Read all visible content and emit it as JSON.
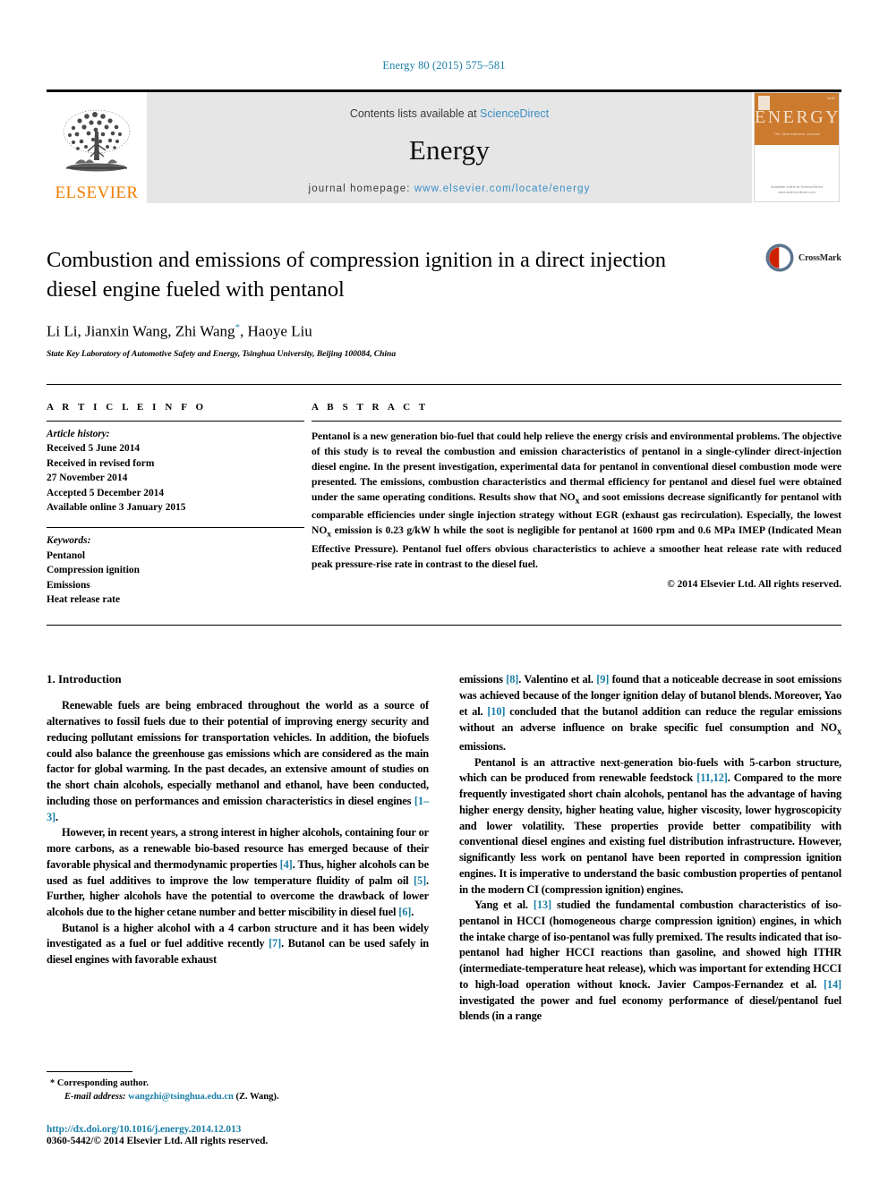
{
  "running_head": "Energy 80 (2015) 575–581",
  "masthead": {
    "publisher_logo_name": "elsevier-tree-logo",
    "publisher_wordmark": "ELSEVIER",
    "contents_prefix": "Contents lists available at ",
    "contents_link": "ScienceDirect",
    "journal_name": "Energy",
    "homepage_label": "journal homepage: ",
    "homepage_url": "www.elsevier.com/locate/energy",
    "cover": {
      "title": "ENERGY",
      "issue_label": "Vol 80",
      "subtitle": "The International Journal",
      "footer": "Available online at\nScienceDirect\nwww.sciencedirect.com"
    }
  },
  "article": {
    "title": "Combustion and emissions of compression ignition in a direct injection diesel engine fueled with pentanol",
    "authors": "Li Li, Jianxin Wang, Zhi Wang",
    "author_star": "*",
    "authors_tail": ", Haoye Liu",
    "affiliation": "State Key Laboratory of Automotive Safety and Energy, Tsinghua University, Beijing 100084, China",
    "crossmark_label": "CrossMark"
  },
  "info": {
    "heading": "A R T I C L E  I N F O",
    "history_label": "Article history:",
    "history": [
      "Received 5 June 2014",
      "Received in revised form",
      "27 November 2014",
      "Accepted 5 December 2014",
      "Available online 3 January 2015"
    ],
    "keywords_label": "Keywords:",
    "keywords": [
      "Pentanol",
      "Compression ignition",
      "Emissions",
      "Heat release rate"
    ]
  },
  "abstract": {
    "heading": "A B S T R A C T",
    "paragraphs": [
      "Pentanol is a new generation bio-fuel that could help relieve the energy crisis and environmental problems. The objective of this study is to reveal the combustion and emission characteristics of pentanol in a single-cylinder direct-injection diesel engine. In the present investigation, experimental data for pentanol in conventional diesel combustion mode were presented. The emissions, combustion characteristics and thermal efficiency for pentanol and diesel fuel were obtained under the same operating conditions. Results show that NOx and soot emissions decrease significantly for pentanol with comparable efficiencies under single injection strategy without EGR (exhaust gas recirculation). Especially, the lowest NOx emission is 0.23 g/kW h while the soot is negligible for pentanol at 1600 rpm and 0.6 MPa IMEP (Indicated Mean Effective Pressure). Pentanol fuel offers obvious characteristics to achieve a smoother heat release rate with reduced peak pressure-rise rate in contrast to the diesel fuel."
    ],
    "copyright": "© 2014 Elsevier Ltd. All rights reserved."
  },
  "body": {
    "section_number_title": "1. Introduction",
    "left_paragraphs": [
      "Renewable fuels are being embraced throughout the world as a source of alternatives to fossil fuels due to their potential of improving energy security and reducing pollutant emissions for transportation vehicles. In addition, the biofuels could also balance the greenhouse gas emissions which are considered as the main factor for global warming. In the past decades, an extensive amount of studies on the short chain alcohols, especially methanol and ethanol, have been conducted, including those on performances and emission characteristics in diesel engines [1–3].",
      "However, in recent years, a strong interest in higher alcohols, containing four or more carbons, as a renewable bio-based resource has emerged because of their favorable physical and thermodynamic properties [4]. Thus, higher alcohols can be used as fuel additives to improve the low temperature fluidity of palm oil [5]. Further, higher alcohols have the potential to overcome the drawback of lower alcohols due to the higher cetane number and better miscibility in diesel fuel [6].",
      "Butanol is a higher alcohol with a 4 carbon structure and it has been widely investigated as a fuel or fuel additive recently [7]. Butanol can be used safely in diesel engines with favorable exhaust"
    ],
    "right_paragraphs": [
      "emissions [8]. Valentino et al. [9] found that a noticeable decrease in soot emissions was achieved because of the longer ignition delay of butanol blends. Moreover, Yao et al. [10] concluded that the butanol addition can reduce the regular emissions without an adverse influence on brake specific fuel consumption and NOx emissions.",
      "Pentanol is an attractive next-generation bio-fuels with 5-carbon structure, which can be produced from renewable feedstock [11,12]. Compared to the more frequently investigated short chain alcohols, pentanol has the advantage of having higher energy density, higher heating value, higher viscosity, lower hygroscopicity and lower volatility. These properties provide better compatibility with conventional diesel engines and existing fuel distribution infrastructure. However, significantly less work on pentanol have been reported in compression ignition engines. It is imperative to understand the basic combustion properties of pentanol in the modern CI (compression ignition) engines.",
      "Yang et al. [13] studied the fundamental combustion characteristics of iso-pentanol in HCCI (homogeneous charge compression ignition) engines, in which the intake charge of iso-pentanol was fully premixed. The results indicated that iso-pentanol had higher HCCI reactions than gasoline, and showed high ITHR (intermediate-temperature heat release), which was important for extending HCCI to high-load operation without knock. Javier Campos-Fernandez et al. [14] investigated the power and fuel economy performance of diesel/pentanol fuel blends (in a range"
    ]
  },
  "footnotes": {
    "corresponding_marker": "*",
    "corresponding_label": "Corresponding author.",
    "email_label": "E-mail address:",
    "email": "wangzhi@tsinghua.edu.cn",
    "email_suffix": "(Z. Wang).",
    "doi": "http://dx.doi.org/10.1016/j.energy.2014.12.013",
    "issn_line": "0360-5442/© 2014 Elsevier Ltd. All rights reserved."
  },
  "colors": {
    "link_blue": "#1a7fa8",
    "sciencedirect_blue": "#3a8fc4",
    "elsevier_orange": "#f07d00",
    "band_grey": "#e6e6e6",
    "cover_orange": "#cc7a2e"
  }
}
